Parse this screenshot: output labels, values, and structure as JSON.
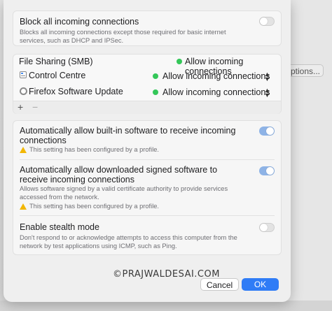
{
  "background": {
    "options_button_label": "ptions..."
  },
  "block_all": {
    "title": "Block all incoming connections",
    "description": "Blocks all incoming connections except those required for basic internet services, such as DHCP and IPSec.",
    "enabled": false
  },
  "apps": {
    "rows": [
      {
        "name": "File Sharing (SMB)",
        "status": "Allow incoming connections",
        "has_stepper": false,
        "icon": "none"
      },
      {
        "name": "Control Centre",
        "status": "Allow incoming connections",
        "has_stepper": true,
        "icon": "control-centre-icon"
      },
      {
        "name": "Firefox Software Update",
        "status": "Allow incoming connections",
        "has_stepper": true,
        "icon": "firefox-update-icon"
      }
    ],
    "add_label": "+",
    "remove_label": "−"
  },
  "settings": {
    "builtin": {
      "title": "Automatically allow built-in software to receive incoming connections",
      "warning": "This setting has been configured by a profile.",
      "enabled": true
    },
    "signed": {
      "title": "Automatically allow downloaded signed software to receive incoming connections",
      "description": "Allows software signed by a valid certificate authority to provide services accessed from the network.",
      "warning": "This setting has been configured by a profile.",
      "enabled": true
    },
    "stealth": {
      "title": "Enable stealth mode",
      "description": "Don't respond to or acknowledge attempts to access this computer from the network by test applications using ICMP, such as Ping.",
      "enabled": false
    }
  },
  "watermark": "©PRAJWALDESAI.COM",
  "buttons": {
    "cancel": "Cancel",
    "ok": "OK"
  },
  "colors": {
    "accent": "#2f7cf6",
    "toggle_on": "#8eb3e6",
    "status_green": "#34c759",
    "warning": "#f2b705"
  }
}
